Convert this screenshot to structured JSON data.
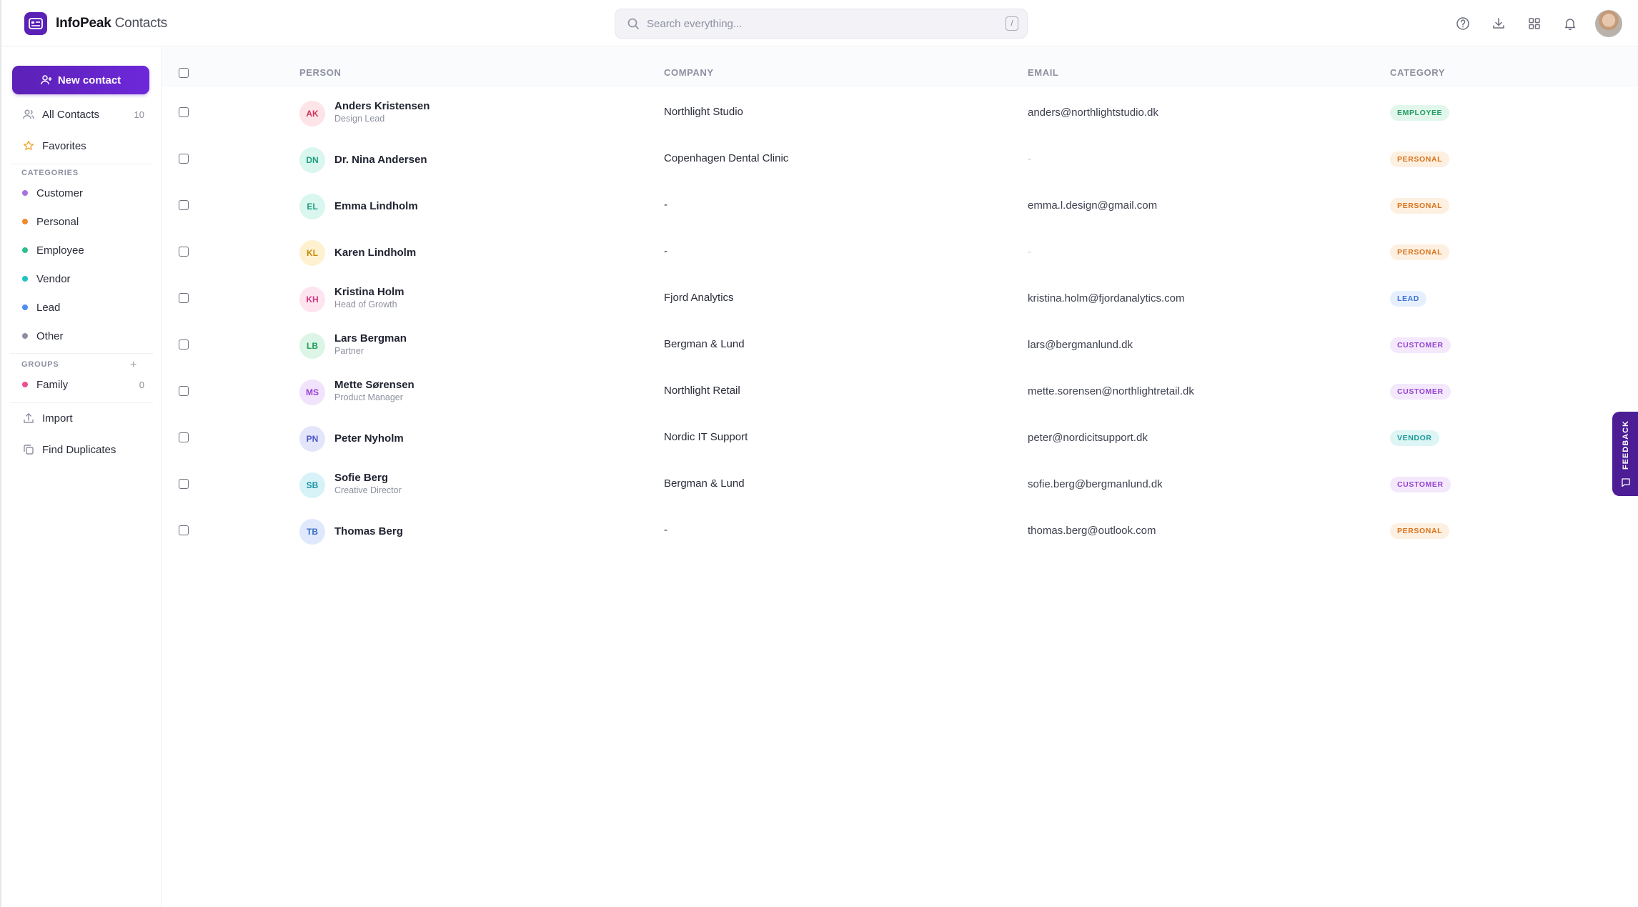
{
  "app": {
    "name": "InfoPeak",
    "module": "Contacts"
  },
  "search": {
    "placeholder": "Search everything...",
    "shortcut": "/"
  },
  "topbar": {
    "icons": [
      "help-icon",
      "download-icon",
      "apps-grid-icon",
      "bell-icon"
    ]
  },
  "sidebar": {
    "new_contact_label": "New contact",
    "nav": [
      {
        "label": "All Contacts",
        "count": "10",
        "icon": "users-icon"
      },
      {
        "label": "Favorites",
        "icon": "star-icon"
      }
    ],
    "categories_title": "CATEGORIES",
    "categories": [
      {
        "label": "Customer",
        "color": "#a970e0"
      },
      {
        "label": "Personal",
        "color": "#f08a2c"
      },
      {
        "label": "Employee",
        "color": "#2fbf8a"
      },
      {
        "label": "Vendor",
        "color": "#1ec4c4"
      },
      {
        "label": "Lead",
        "color": "#4d8ef0"
      },
      {
        "label": "Other",
        "color": "#8a8fa3"
      }
    ],
    "groups_title": "GROUPS",
    "add_group": "+",
    "groups": [
      {
        "label": "Family",
        "count": "0",
        "color": "#ec4f8e"
      }
    ],
    "tools": [
      {
        "label": "Import",
        "icon": "upload-icon"
      },
      {
        "label": "Find Duplicates",
        "icon": "duplicate-icon"
      }
    ]
  },
  "table": {
    "headers": {
      "person": "PERSON",
      "company": "COMPANY",
      "email": "EMAIL",
      "category": "CATEGORY"
    },
    "rows": [
      {
        "initials": "AK",
        "name": "Anders Kristensen",
        "title": "Design Lead",
        "company": "Northlight Studio",
        "email": "anders@northlightstudio.dk",
        "category": "EMPLOYEE"
      },
      {
        "initials": "DN",
        "name": "Dr. Nina Andersen",
        "title": "",
        "company": "Copenhagen Dental Clinic",
        "email": "-",
        "category": "PERSONAL"
      },
      {
        "initials": "EL",
        "name": "Emma Lindholm",
        "title": "",
        "company": "-",
        "email": "emma.l.design@gmail.com",
        "category": "PERSONAL"
      },
      {
        "initials": "KL",
        "name": "Karen Lindholm",
        "title": "",
        "company": "-",
        "email": "-",
        "category": "PERSONAL"
      },
      {
        "initials": "KH",
        "name": "Kristina Holm",
        "title": "Head of Growth",
        "company": "Fjord Analytics",
        "email": "kristina.holm@fjordanalytics.com",
        "category": "LEAD"
      },
      {
        "initials": "LB",
        "name": "Lars Bergman",
        "title": "Partner",
        "company": "Bergman & Lund",
        "email": "lars@bergmanlund.dk",
        "category": "CUSTOMER"
      },
      {
        "initials": "MS",
        "name": "Mette Sørensen",
        "title": "Product Manager",
        "company": "Northlight Retail",
        "email": "mette.sorensen@northlightretail.dk",
        "category": "CUSTOMER"
      },
      {
        "initials": "PN",
        "name": "Peter Nyholm",
        "title": "",
        "company": "Nordic IT Support",
        "email": "peter@nordicitsupport.dk",
        "category": "VENDOR"
      },
      {
        "initials": "SB",
        "name": "Sofie Berg",
        "title": "Creative Director",
        "company": "Bergman & Lund",
        "email": "sofie.berg@bergmanlund.dk",
        "category": "CUSTOMER"
      },
      {
        "initials": "TB",
        "name": "Thomas Berg",
        "title": "",
        "company": "-",
        "email": "thomas.berg@outlook.com",
        "category": "PERSONAL"
      }
    ]
  },
  "avatar_colors": {
    "AK": {
      "bg": "#fde4e8",
      "fg": "#d0345a"
    },
    "DN": {
      "bg": "#d9f6ef",
      "fg": "#1e9e82"
    },
    "EL": {
      "bg": "#d9f6ef",
      "fg": "#1e9e82"
    },
    "KL": {
      "bg": "#fdf1cf",
      "fg": "#c98a0c"
    },
    "KH": {
      "bg": "#fde4ef",
      "fg": "#d0347d"
    },
    "LB": {
      "bg": "#dcf5e6",
      "fg": "#25a05a"
    },
    "MS": {
      "bg": "#f1e3fb",
      "fg": "#9a3fd0"
    },
    "PN": {
      "bg": "#e3e6fb",
      "fg": "#4c54c8"
    },
    "SB": {
      "bg": "#d8f3f7",
      "fg": "#1a93a8"
    },
    "TB": {
      "bg": "#dfe9fb",
      "fg": "#3d6dc6"
    }
  },
  "badge_colors": {
    "EMPLOYEE": {
      "bg": "#e2f7ec",
      "fg": "#229c60"
    },
    "PERSONAL": {
      "bg": "#fdf0e1",
      "fg": "#d9731c"
    },
    "LEAD": {
      "bg": "#e6effd",
      "fg": "#3b72d9"
    },
    "CUSTOMER": {
      "bg": "#f3e8fc",
      "fg": "#9644cf"
    },
    "VENDOR": {
      "bg": "#ddf5f4",
      "fg": "#1c9a98"
    }
  },
  "feedback": {
    "label": "FEEDBACK"
  }
}
